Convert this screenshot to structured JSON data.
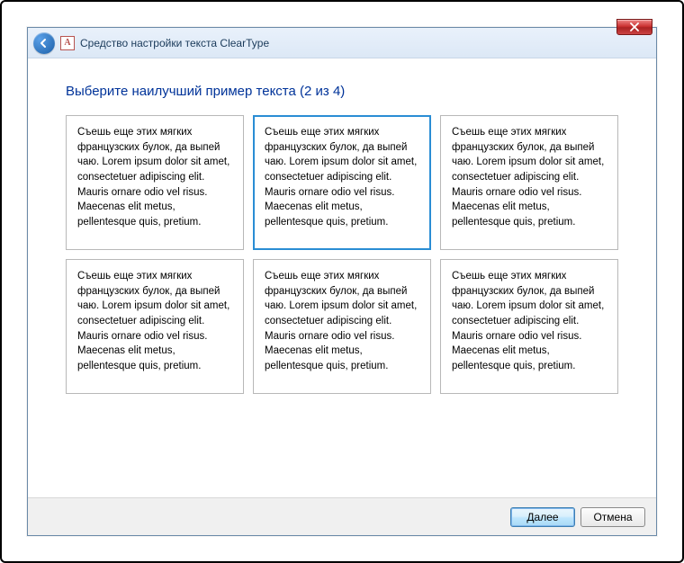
{
  "window": {
    "title": "Средство настройки текста ClearType"
  },
  "heading": "Выберите наилучший пример текста (2 из 4)",
  "sample_text": "Съешь еще этих мягких французских булок, да выпей чаю. Lorem ipsum dolor sit amet, consectetuer adipiscing elit. Mauris ornare odio vel risus. Maecenas elit metus, pellentesque quis, pretium.",
  "selected_index": 1,
  "buttons": {
    "next": "Далее",
    "cancel": "Отмена"
  },
  "icons": {
    "app_letter": "A"
  }
}
